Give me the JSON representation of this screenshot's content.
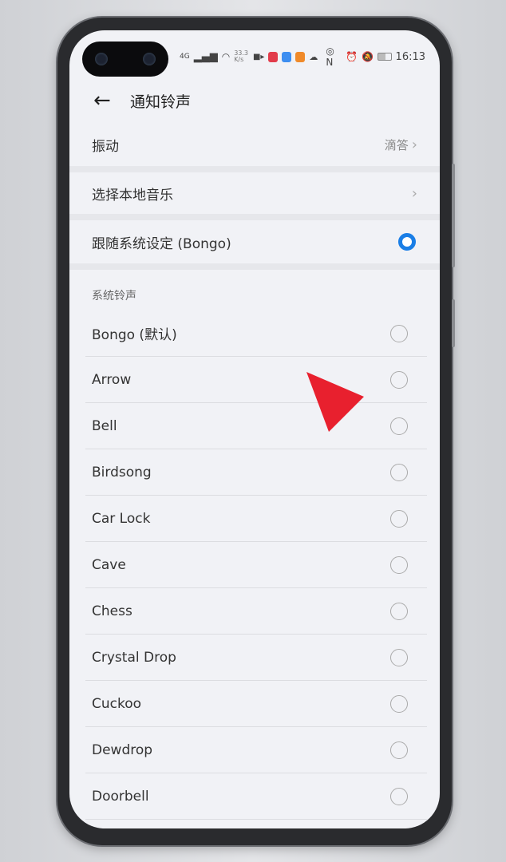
{
  "status": {
    "network": "4G",
    "speed": "33.3 K/s",
    "time": "16:13"
  },
  "header": {
    "back_icon": "arrow-left-icon",
    "title": "通知铃声"
  },
  "vibration": {
    "label": "振动",
    "value": "滴答"
  },
  "local_music": {
    "label": "选择本地音乐"
  },
  "follow_system": {
    "label": "跟随系统设定 (Bongo)",
    "selected": true
  },
  "section_title": "系统铃声",
  "ringtones": [
    {
      "label": "Bongo (默认)",
      "selected": false
    },
    {
      "label": "Arrow",
      "selected": false
    },
    {
      "label": "Bell",
      "selected": false
    },
    {
      "label": "Birdsong",
      "selected": false
    },
    {
      "label": "Car Lock",
      "selected": false
    },
    {
      "label": "Cave",
      "selected": false
    },
    {
      "label": "Chess",
      "selected": false
    },
    {
      "label": "Crystal Drop",
      "selected": false
    },
    {
      "label": "Cuckoo",
      "selected": false
    },
    {
      "label": "Dewdrop",
      "selected": false
    },
    {
      "label": "Doorbell",
      "selected": false
    }
  ],
  "colors": {
    "accent": "#1a7ee6",
    "cursor": "#e8202e"
  }
}
